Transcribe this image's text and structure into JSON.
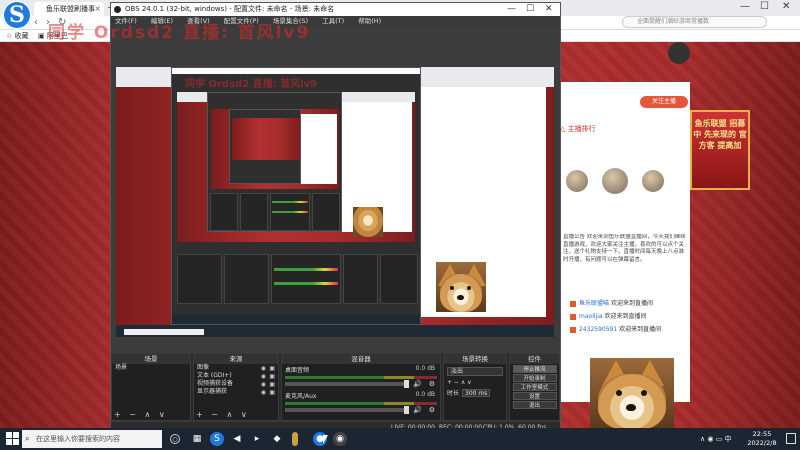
{
  "browser": {
    "tab_title": "鱼乐联盟刷播事",
    "tab_close": "×",
    "newtab": "+",
    "back": "‹",
    "forward": "›",
    "refresh": "↻",
    "search_placeholder": "全面提醒们潮砂游商常播数",
    "bookmarks": [
      "☆ 收藏",
      "▣ 阿里巴"
    ],
    "win_minimize": "—",
    "win_maximize": "☐",
    "win_close": "✕",
    "banner_text": "鱼乐联盟 招募中 先来现的 官方客 提高加",
    "panel_title": "△ 主播排行",
    "follow_button": "关注主播",
    "text_block": "直播公告 欢迎来到鱼乐联盟直播间，今天我们继续直播游戏，欢迎大家关注主播，喜欢的可以点个关注，送个礼物支持一下。直播时间每天晚上八点准时开播，有问题可以在弹幕留言。",
    "list": [
      {
        "user": "鱼乐联盟喵",
        "text": "欢迎来到直播间"
      },
      {
        "user": "maolijia",
        "text": "欢迎来到直播间"
      },
      {
        "user": "2432590591",
        "text": "欢迎来到直播间"
      }
    ]
  },
  "watermark": {
    "line1": "同学 Ordsd2  直播: 首风lv9",
    "line2": "同学 Ordsd2 直播: 首风lv9"
  },
  "obs": {
    "title": "OBS 24.0.1 (32-bit, windows) - 配置文件: 未命名 - 场景: 未命名",
    "menu": [
      "文件(F)",
      "编辑(E)",
      "查看(V)",
      "配置文件(P)",
      "场景集合(S)",
      "工具(T)",
      "帮助(H)"
    ],
    "win_minimize": "—",
    "win_maximize": "☐",
    "win_close": "✕",
    "docks": {
      "scenes": {
        "title": "场景",
        "items": [
          "场景"
        ]
      },
      "sources": {
        "title": "来源",
        "items": [
          "图像",
          "文本 (GDI+)",
          "视频捕获设备",
          "显示器捕获"
        ]
      },
      "mixer": {
        "title": "混音器",
        "channels": [
          {
            "name": "桌面音频",
            "db": "0.0 dB"
          },
          {
            "name": "麦克风/Aux",
            "db": "0.0 dB"
          }
        ]
      },
      "transitions": {
        "title": "场景转换",
        "selected": "淡出",
        "duration_label": "时长",
        "duration": "300 ms"
      },
      "controls": {
        "title": "控件",
        "buttons": [
          "停止推流",
          "开始录制",
          "工作室模式",
          "设置",
          "退出"
        ]
      }
    },
    "tools": "+ − ∧ ∨",
    "status": {
      "live": "LIVE: 00:00:00",
      "rec": "REC: 00:00:00",
      "cpu": "CPU: 1.0%, 60.00 fps"
    }
  },
  "taskbar": {
    "search_placeholder": "在这里输入你要搜索的内容",
    "time": "22:55",
    "date": "2022/2/8",
    "tray": "∧ ◉ ▭ 中"
  }
}
